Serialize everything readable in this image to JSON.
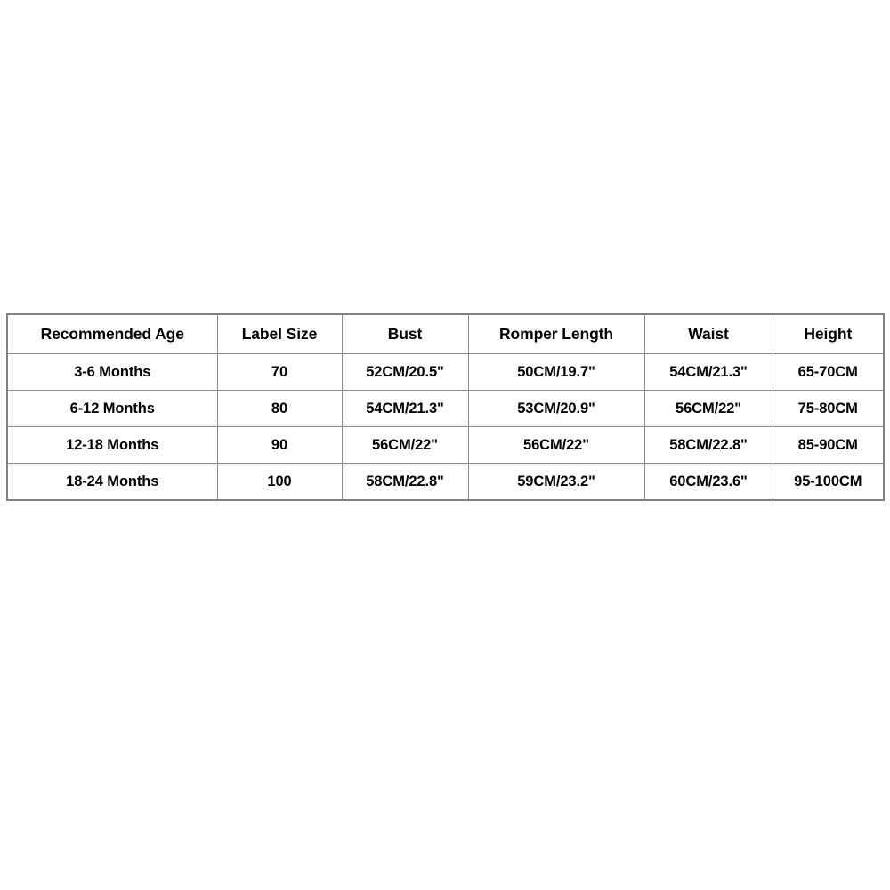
{
  "page": {
    "background_color": "#ffffff",
    "table_border_color": "#828282",
    "table_grid_color": "#8a8a8a",
    "text_color": "#000000"
  },
  "chart_data": {
    "type": "table",
    "title": "",
    "columns": [
      "Recommended Age",
      "Label Size",
      "Bust",
      "Romper Length",
      "Waist",
      "Height"
    ],
    "rows": [
      [
        "3-6 Months",
        "70",
        "52CM/20.5\"",
        "50CM/19.7\"",
        "54CM/21.3\"",
        "65-70CM"
      ],
      [
        "6-12 Months",
        "80",
        "54CM/21.3\"",
        "53CM/20.9\"",
        "56CM/22\"",
        "75-80CM"
      ],
      [
        "12-18 Months",
        "90",
        "56CM/22\"",
        "56CM/22\"",
        "58CM/22.8\"",
        "85-90CM"
      ],
      [
        "18-24 Months",
        "100",
        "58CM/22.8\"",
        "59CM/23.2\"",
        "60CM/23.6\"",
        "95-100CM"
      ]
    ]
  },
  "size_chart": {
    "headers": {
      "age": "Recommended Age",
      "label_size": "Label Size",
      "bust": "Bust",
      "romper_length": "Romper Length",
      "waist": "Waist",
      "height": "Height"
    },
    "rows": [
      {
        "age": "3-6 Months",
        "label_size": "70",
        "bust": "52CM/20.5\"",
        "romper_length": "50CM/19.7\"",
        "waist": "54CM/21.3\"",
        "height": "65-70CM"
      },
      {
        "age": "6-12 Months",
        "label_size": "80",
        "bust": "54CM/21.3\"",
        "romper_length": "53CM/20.9\"",
        "waist": "56CM/22\"",
        "height": "75-80CM"
      },
      {
        "age": "12-18 Months",
        "label_size": "90",
        "bust": "56CM/22\"",
        "romper_length": "56CM/22\"",
        "waist": "58CM/22.8\"",
        "height": "85-90CM"
      },
      {
        "age": "18-24 Months",
        "label_size": "100",
        "bust": "58CM/22.8\"",
        "romper_length": "59CM/23.2\"",
        "waist": "60CM/23.6\"",
        "height": "95-100CM"
      }
    ]
  }
}
